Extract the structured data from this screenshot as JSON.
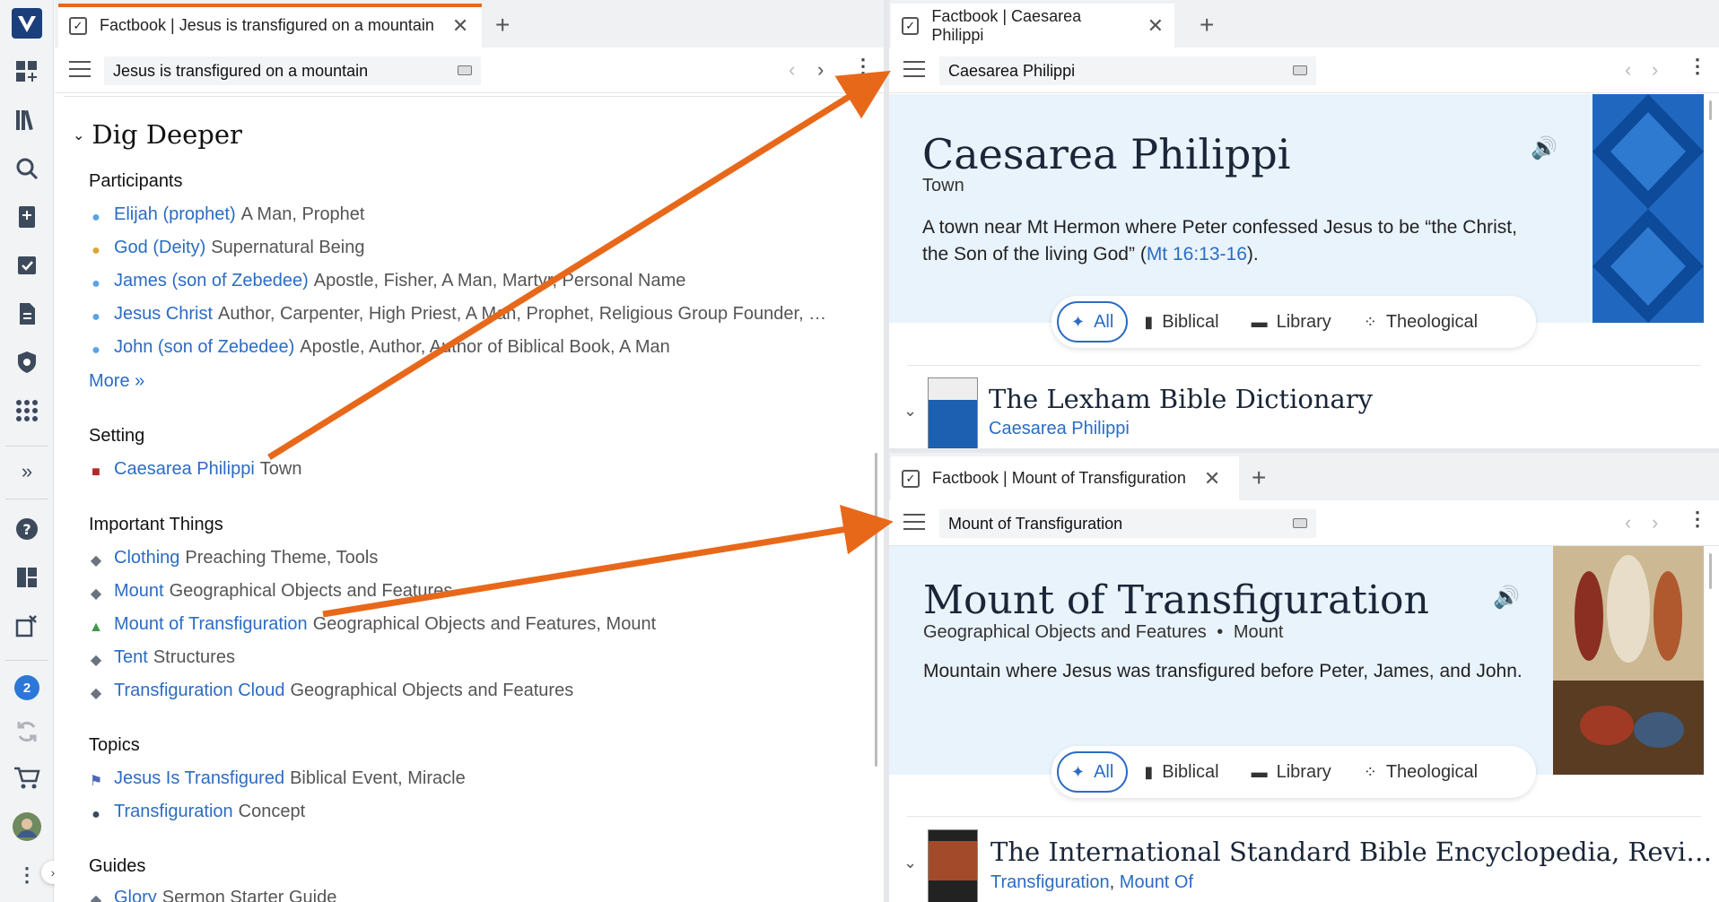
{
  "rail": {
    "badge_count": "2",
    "expand_glyph": "»"
  },
  "left_panel": {
    "tab_title": "Factbook | Jesus is transfigured on a mountain",
    "address": "Jesus is transfigured on a mountain",
    "section_heading": "Dig Deeper",
    "participants": {
      "title": "Participants",
      "items": [
        {
          "name": "Elijah (prophet)",
          "desc": "A Man, Prophet",
          "icon": "person-icon"
        },
        {
          "name": "God (Deity)",
          "desc": "Supernatural Being",
          "icon": "deity-icon"
        },
        {
          "name": "James (son of Zebedee)",
          "desc": "Apostle, Fisher, A Man, Martyr, Personal Name",
          "icon": "person-icon"
        },
        {
          "name": "Jesus Christ",
          "desc": "Author, Carpenter, High Priest, A Man, Prophet, Religious Group Founder, …",
          "icon": "person-icon"
        },
        {
          "name": "John (son of Zebedee)",
          "desc": "Apostle, Author, Author of Biblical Book, A Man",
          "icon": "person-icon"
        }
      ],
      "more": "More »"
    },
    "setting": {
      "title": "Setting",
      "items": [
        {
          "name": "Caesarea Philippi",
          "desc": "Town",
          "icon": "place-icon"
        }
      ]
    },
    "things": {
      "title": "Important Things",
      "items": [
        {
          "name": "Clothing",
          "desc": "Preaching Theme, Tools",
          "icon": "cube-icon"
        },
        {
          "name": "Mount",
          "desc": "Geographical Objects and Features",
          "icon": "cube-icon"
        },
        {
          "name": "Mount of Transfiguration",
          "desc": "Geographical Objects and Features, Mount",
          "icon": "mountain-icon"
        },
        {
          "name": "Tent",
          "desc": "Structures",
          "icon": "cube-icon"
        },
        {
          "name": "Transfiguration Cloud",
          "desc": "Geographical Objects and Features",
          "icon": "cube-icon"
        }
      ]
    },
    "topics": {
      "title": "Topics",
      "items": [
        {
          "name": "Jesus Is Transfigured",
          "desc": "Biblical Event, Miracle",
          "icon": "flag-icon"
        },
        {
          "name": "Transfiguration",
          "desc": "Concept",
          "icon": "bubble-icon"
        }
      ]
    },
    "guides": {
      "title": "Guides",
      "items": [
        {
          "name": "Glory",
          "desc": "Sermon Starter Guide",
          "icon": "cube-icon"
        }
      ]
    }
  },
  "top_right": {
    "tab_title": "Factbook | Caesarea Philippi",
    "address": "Caesarea Philippi",
    "title": "Caesarea Philippi",
    "subtitle": "Town",
    "body_text": "A town near Mt Hermon where Peter confessed Jesus to be “the Christ, the Son of the living God” (",
    "body_ref": "Mt 16:13-16",
    "body_end": ").",
    "filters": [
      "All",
      "Biblical",
      "Library",
      "Theological"
    ],
    "book_title": "The Lexham Bible Dictionary",
    "book_sub": "Caesarea Philippi"
  },
  "bottom_right": {
    "tab_title": "Factbook | Mount of Transfiguration",
    "address": "Mount of Transfiguration",
    "title": "Mount of Transfiguration",
    "subtitle_a": "Geographical Objects and Features",
    "subtitle_sep": "•",
    "subtitle_b": "Mount",
    "body_text": "Mountain where Jesus was transfigured before Peter, James, and John.",
    "filters": [
      "All",
      "Biblical",
      "Library",
      "Theological"
    ],
    "book_title": "The International Standard Bible Encyclopedia, Revi…",
    "book_sub_a": "Transfiguration",
    "book_sub_sep": ", ",
    "book_sub_b": "Mount Of"
  },
  "colors": {
    "accent_orange": "#e8681a",
    "link_blue": "#2b6cc4",
    "hero_bg": "#e9f3fc"
  }
}
